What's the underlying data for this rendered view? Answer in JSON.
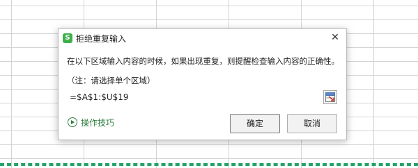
{
  "dialog": {
    "title": "拒绝重复输入",
    "app_icon_letter": "S",
    "close_glyph": "✕",
    "message": "在以下区域输入内容的时候，如果出现重复，则提醒检查输入内容的正确性。",
    "note": "（注：请选择单个区域）",
    "range_value": "=$A$1:$U$19",
    "tips_label": "操作技巧",
    "ok_label": "确定",
    "cancel_label": "取消"
  },
  "colors": {
    "app_icon": "#3eb04b",
    "tips_link": "#2f7d40",
    "selection_marquee": "#21a366"
  },
  "icons": [
    "wps-app-icon",
    "close-icon",
    "range-picker-icon",
    "play-circle-icon"
  ]
}
